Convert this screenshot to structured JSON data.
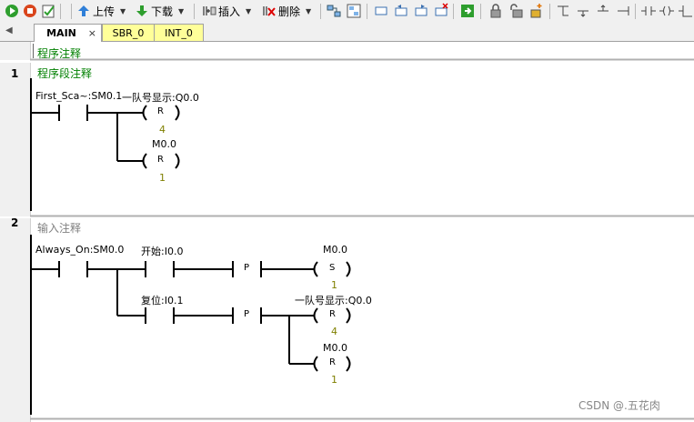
{
  "toolbar": {
    "upload_label": "上传",
    "download_label": "下载",
    "insert_label": "插入",
    "delete_label": "删除"
  },
  "tabs": [
    {
      "label": "MAIN",
      "close": "×"
    },
    {
      "label": "SBR_0"
    },
    {
      "label": "INT_0"
    }
  ],
  "program_comment": "程序注释",
  "networks": [
    {
      "number": "1",
      "comment": "程序段注释",
      "contact1": "First_Sca~:SM0.1",
      "coil1_addr": "一队号显示:Q0.0",
      "coil1_type": "R",
      "coil1_n": "4",
      "coil2_addr": "M0.0",
      "coil2_type": "R",
      "coil2_n": "1"
    },
    {
      "number": "2",
      "comment": "输入注释",
      "contact1": "Always_On:SM0.0",
      "contact2": "开始:I0.0",
      "contact3": "复位:I0.1",
      "p_label": "P",
      "coil1_addr": "M0.0",
      "coil1_type": "S",
      "coil1_n": "1",
      "coil2_addr": "一队号显示:Q0.0",
      "coil2_type": "R",
      "coil2_n": "4",
      "coil3_addr": "M0.0",
      "coil3_type": "R",
      "coil3_n": "1"
    }
  ],
  "watermark": "CSDN @.五花肉",
  "colors": {
    "comment_green": "#008000",
    "param_olive": "#808000",
    "comment_gray": "#808080"
  }
}
